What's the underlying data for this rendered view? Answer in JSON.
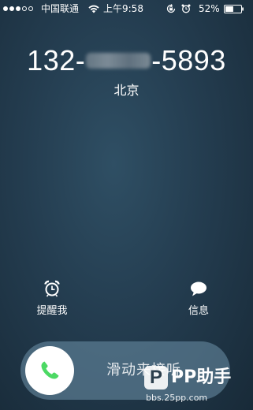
{
  "status_bar": {
    "signal_dots_filled": 3,
    "signal_dots_total": 5,
    "carrier": "中国联通",
    "time": "上午9:58",
    "battery_percent": "52%",
    "battery_level": 0.52
  },
  "caller": {
    "number_prefix": "132-",
    "number_suffix": "-5893",
    "location": "北京"
  },
  "actions": {
    "remind_label": "提醒我",
    "message_label": "信息"
  },
  "slider": {
    "label": "滑动来接听"
  },
  "watermark": {
    "brand": "PP助手",
    "logo_letter": "P",
    "url": "bbs.25pp.com"
  },
  "colors": {
    "accept_green": "#4cd964",
    "background": "#243d50"
  }
}
